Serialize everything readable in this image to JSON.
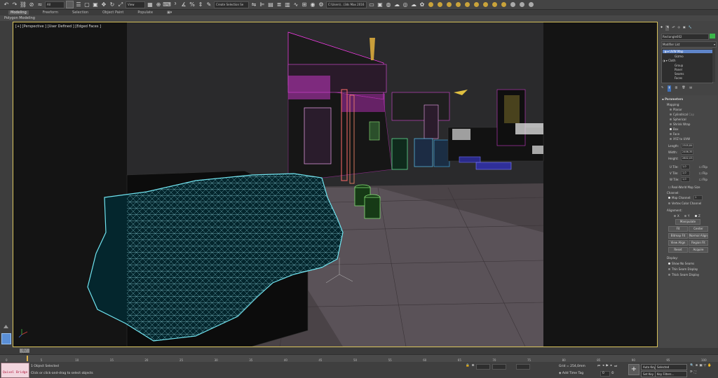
{
  "toolbar": {
    "selection_filter": "All",
    "view_dropdown": "View",
    "named_selection": "Create Selection Se",
    "project_path": "C:\\Users\\...\\3ds Max 2016"
  },
  "ribbon": {
    "tabs": [
      "Modeling",
      "Freeform",
      "Selection",
      "Object Paint",
      "Populate"
    ],
    "active_tab": "Modeling",
    "panel": "Polygon Modeling"
  },
  "viewport": {
    "label": "[+] [Perspective ] [User Defined ] [Edged Faces ]"
  },
  "command_panel": {
    "object_name": "Rectangle002",
    "modifier_list": "Modifier List",
    "stack": [
      {
        "label": "UVW Map",
        "selected": true
      },
      {
        "label": "Gizmo"
      },
      {
        "label": "Cloth"
      },
      {
        "label": "Group"
      },
      {
        "label": "Panel"
      },
      {
        "label": "Seams"
      },
      {
        "label": "Faces"
      }
    ],
    "parameters": {
      "heading": "Parameters",
      "mapping_label": "Mapping:",
      "mapping_options": [
        "Planar",
        "Cylindrical",
        "Spherical",
        "Shrink Wrap",
        "Box",
        "Face",
        "XYZ to UVW"
      ],
      "mapping_selected": "Box",
      "cap_label": "Cap",
      "length_label": "Length:",
      "length": "2305,84",
      "width_label": "Width:",
      "width": "2406,35",
      "height_label": "Height:",
      "height": "2802,03",
      "utile_label": "U Tile:",
      "utile": "1,0",
      "vtile_label": "V Tile:",
      "vtile": "1,0",
      "wtile_label": "W Tile:",
      "wtile": "1,0",
      "flip_label": "Flip",
      "real_world": "Real-World Map Size",
      "channel_label": "Channel:",
      "map_channel": "Map Channel:",
      "map_channel_value": "1",
      "vertex_color": "Vertex Color Channel",
      "alignment_label": "Alignment:",
      "axes": [
        "X",
        "Y",
        "Z"
      ],
      "manipulate": "Manipulate",
      "buttons": [
        "Fit",
        "Center",
        "Bitmap Fit",
        "Normal Align",
        "View Align",
        "Region Fit",
        "Reset",
        "Acquire"
      ],
      "display_label": "Display:",
      "display_options": [
        "Show No Seams",
        "Thin Seam Display",
        "Thick Seam Display"
      ]
    }
  },
  "timeline": {
    "slider": "0 / 100",
    "ticks": [
      "0",
      "5",
      "10",
      "15",
      "20",
      "25",
      "30",
      "35",
      "40",
      "45",
      "50",
      "55",
      "60",
      "65",
      "70",
      "75",
      "80",
      "85",
      "90",
      "95",
      "100"
    ]
  },
  "status": {
    "maxscript": "Quixel Bridge",
    "selected": "1 Object Selected",
    "prompt": "Click or click-and-drag to select objects",
    "grid": "Grid = 254,0mm",
    "add_time_tag": "Add Time Tag",
    "auto_key": "Auto Key",
    "set_key": "Set Key",
    "selected_dropdown": "Selected",
    "key_filters": "Key Filters...",
    "frame": "0"
  },
  "colors": {
    "cloth_wire": "#7fe9f2",
    "viewport_border": "#d6c15a",
    "background": "#444444"
  }
}
